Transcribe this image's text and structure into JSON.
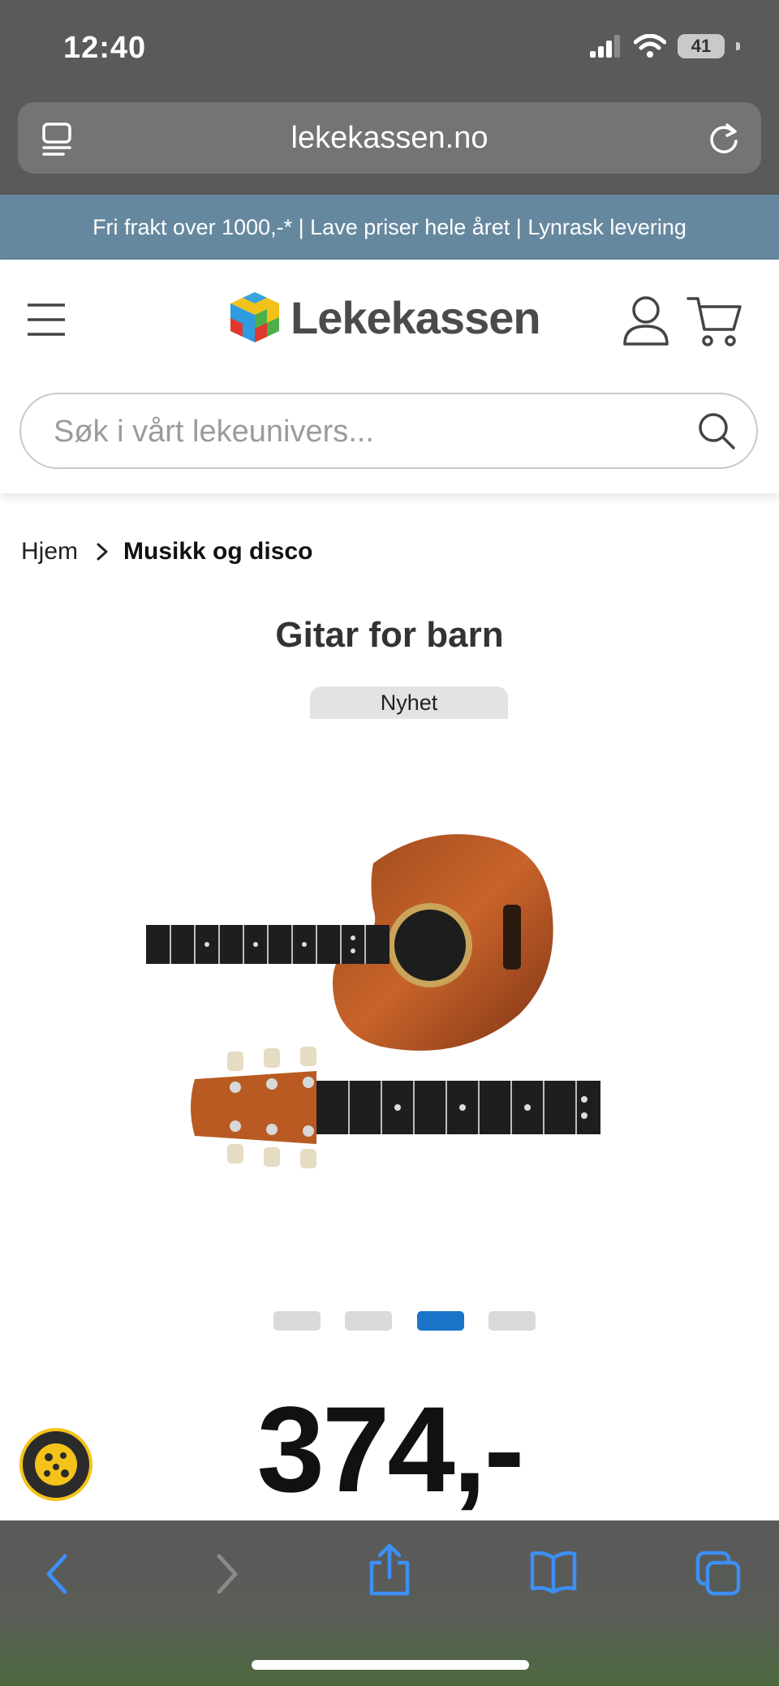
{
  "status_bar": {
    "time": "12:40",
    "battery": "41"
  },
  "browser": {
    "url": "lekekassen.no"
  },
  "promo_banner": {
    "text": "Fri frakt over 1000,-* | Lave priser hele året | Lynrask levering"
  },
  "header": {
    "logo_text": "Lekekassen",
    "search_placeholder": "Søk i vårt lekeunivers..."
  },
  "breadcrumb": {
    "home": "Hjem",
    "current": "Musikk og disco"
  },
  "product": {
    "title": "Gitar for barn",
    "badge": "Nyhet",
    "price": "374,-",
    "gallery": {
      "image_count": 4,
      "active_index": 2
    }
  },
  "colors": {
    "promo_bg": "#66889f",
    "active_dot": "#1b74c9",
    "toolbar_icon": "#3d8ff5",
    "cookie_ring": "#f4c31a"
  },
  "icons": [
    "tabs-icon",
    "reload-icon",
    "menu-icon",
    "user-icon",
    "cart-icon",
    "search-icon",
    "chevron-right-icon",
    "cookie-icon",
    "back-icon",
    "forward-icon",
    "share-icon",
    "bookmarks-icon",
    "tabs-overview-icon"
  ]
}
